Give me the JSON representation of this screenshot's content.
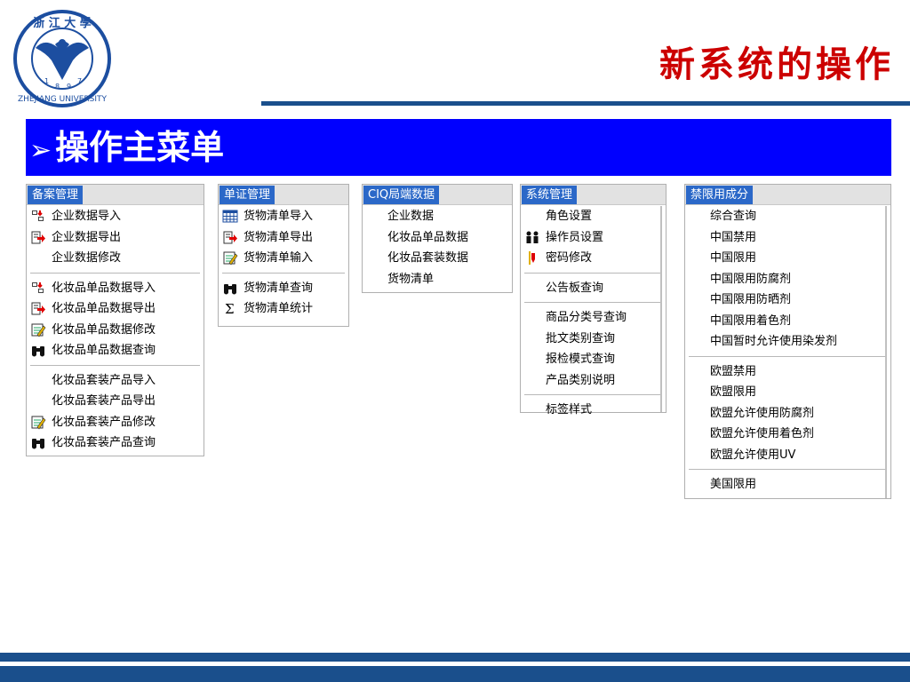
{
  "slide": {
    "title": "新系统的操作",
    "banner_arrow": "➢",
    "banner_title": "操作主菜单"
  },
  "logo": {
    "top_text": "浙 江 大 學",
    "year_digits": [
      "1",
      "8",
      "9",
      "7"
    ],
    "bottom_text": "ZHEJIANG UNIVERSITY"
  },
  "menus": [
    {
      "header": "备案管理",
      "groups": [
        [
          {
            "label": "企业数据导入",
            "icon": "import-icon"
          },
          {
            "label": "企业数据导出",
            "icon": "export-icon"
          },
          {
            "label": "企业数据修改",
            "icon": ""
          }
        ],
        [
          {
            "label": "化妆品单品数据导入",
            "icon": "import-icon"
          },
          {
            "label": "化妆品单品数据导出",
            "icon": "export-icon"
          },
          {
            "label": "化妆品单品数据修改",
            "icon": "edit-icon"
          },
          {
            "label": "化妆品单品数据查询",
            "icon": "binoculars-icon"
          }
        ],
        [
          {
            "label": "化妆品套装产品导入",
            "icon": ""
          },
          {
            "label": "化妆品套装产品导出",
            "icon": ""
          },
          {
            "label": "化妆品套装产品修改",
            "icon": "edit-icon"
          },
          {
            "label": "化妆品套装产品查询",
            "icon": "binoculars-icon"
          }
        ]
      ]
    },
    {
      "header": "单证管理",
      "groups": [
        [
          {
            "label": "货物清单导入",
            "icon": "grid-icon"
          },
          {
            "label": "货物清单导出",
            "icon": "export-icon"
          },
          {
            "label": "货物清单输入",
            "icon": "edit-icon"
          }
        ],
        [
          {
            "label": "货物清单查询",
            "icon": "binoculars-icon"
          },
          {
            "label": "货物清单统计",
            "icon": "sigma-icon"
          }
        ]
      ]
    },
    {
      "header": "CIQ局端数据",
      "groups": [
        [
          {
            "label": "企业数据",
            "icon": ""
          },
          {
            "label": "化妆品单品数据",
            "icon": ""
          },
          {
            "label": "化妆品套装数据",
            "icon": ""
          },
          {
            "label": "货物清单",
            "icon": ""
          }
        ]
      ]
    },
    {
      "header": "系统管理",
      "groups": [
        [
          {
            "label": "角色设置",
            "icon": ""
          },
          {
            "label": "操作员设置",
            "icon": "users-icon"
          },
          {
            "label": "密码修改",
            "icon": "key-icon"
          }
        ],
        [
          {
            "label": "公告板查询",
            "icon": ""
          }
        ],
        [
          {
            "label": "商品分类号查询",
            "icon": ""
          },
          {
            "label": "批文类别查询",
            "icon": ""
          },
          {
            "label": "报检模式查询",
            "icon": ""
          },
          {
            "label": "产品类别说明",
            "icon": ""
          }
        ],
        [
          {
            "label": "标签样式",
            "icon": ""
          }
        ]
      ]
    },
    {
      "header": "禁限用成分",
      "groups": [
        [
          {
            "label": "综合查询",
            "icon": ""
          },
          {
            "label": "中国禁用",
            "icon": ""
          },
          {
            "label": "中国限用",
            "icon": ""
          },
          {
            "label": "中国限用防腐剂",
            "icon": ""
          },
          {
            "label": "中国限用防晒剂",
            "icon": ""
          },
          {
            "label": "中国限用着色剂",
            "icon": ""
          },
          {
            "label": "中国暂时允许使用染发剂",
            "icon": ""
          }
        ],
        [
          {
            "label": "欧盟禁用",
            "icon": ""
          },
          {
            "label": "欧盟限用",
            "icon": ""
          },
          {
            "label": "欧盟允许使用防腐剂",
            "icon": ""
          },
          {
            "label": "欧盟允许使用着色剂",
            "icon": ""
          },
          {
            "label": "欧盟允许使用UV",
            "icon": ""
          }
        ],
        [
          {
            "label": "美国限用",
            "icon": ""
          }
        ]
      ]
    }
  ],
  "colors": {
    "title_red": "#cc0000",
    "banner_blue": "#0000ff",
    "menu_header_blue": "#2b68c8",
    "rule_blue": "#1a4f8c"
  }
}
